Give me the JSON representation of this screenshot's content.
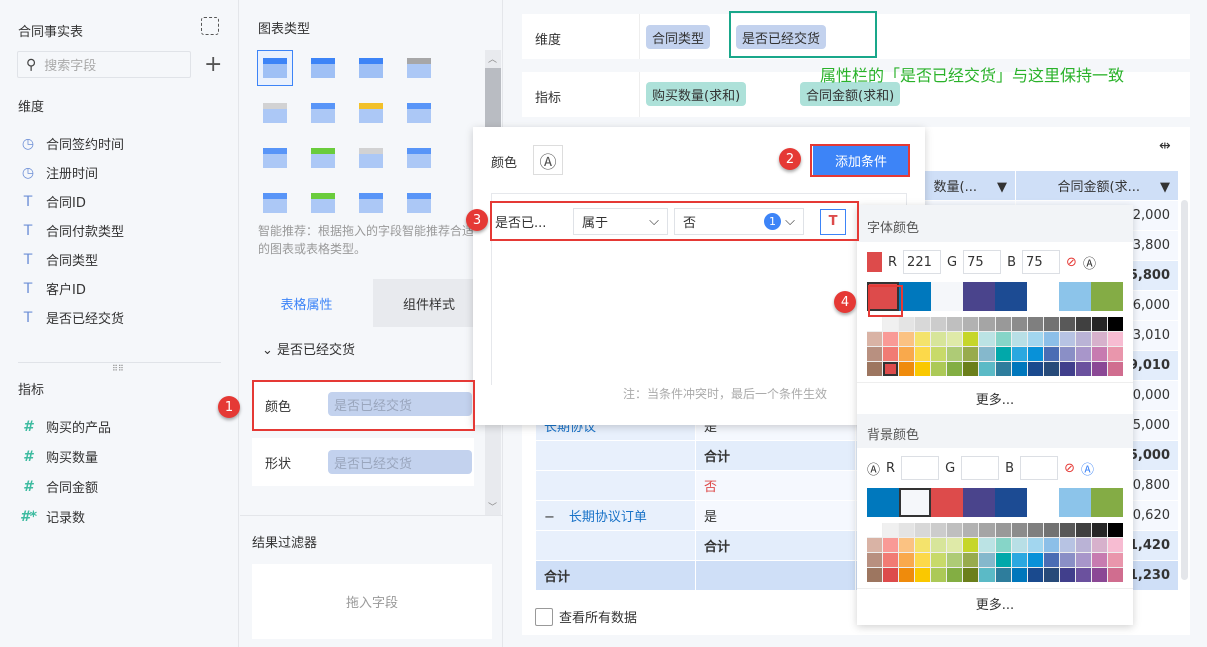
{
  "left": {
    "title": "合同事实表",
    "search_placeholder": "搜索字段",
    "dimensions_label": "维度",
    "dimensions": [
      {
        "icon": "clock-icon",
        "label": "合同签约时间"
      },
      {
        "icon": "clock-icon",
        "label": "注册时间"
      },
      {
        "icon": "text-icon",
        "label": "合同ID"
      },
      {
        "icon": "text-icon",
        "label": "合同付款类型"
      },
      {
        "icon": "text-icon",
        "label": "合同类型"
      },
      {
        "icon": "text-icon",
        "label": "客户ID"
      },
      {
        "icon": "text-icon",
        "label": "是否已经交货"
      }
    ],
    "metrics_label": "指标",
    "metrics": [
      {
        "icon": "number-icon",
        "label": "购买的产品"
      },
      {
        "icon": "number-icon",
        "label": "购买数量"
      },
      {
        "icon": "number-icon",
        "label": "合同金额"
      },
      {
        "icon": "record-count-icon",
        "label": "记录数"
      }
    ]
  },
  "mid": {
    "chart_type_title": "图表类型",
    "hint": "智能推荐：根据拖入的字段智能推荐合适的图表或表格类型。",
    "tabs": [
      "表格属性",
      "组件样式"
    ],
    "section": "是否已经交货",
    "props": [
      {
        "label": "颜色",
        "value": "是否已经交货"
      },
      {
        "label": "形状",
        "value": "是否已经交货"
      }
    ],
    "filter_title": "结果过滤器",
    "filter_placeholder": "拖入字段"
  },
  "top": {
    "dimension_label": "维度",
    "dimensions": [
      "合同类型",
      "是否已经交货"
    ],
    "metric_label": "指标",
    "metrics": [
      "购买数量(求和)",
      "合同金额(求和)"
    ],
    "annotation": "属性栏的「是否已经交货」与这里保持一致"
  },
  "table": {
    "headers": [
      "数量(...",
      "合同金额(求..."
    ],
    "col4": [
      "2,000",
      "3,800",
      "5,800",
      "6,000",
      "3,010",
      "9,010",
      "0,000",
      "5,000",
      "5,000",
      "0,800",
      "0,620",
      "1,420",
      "1,230"
    ],
    "group_partial": "长期协议",
    "group2": "长期协议订单",
    "yes": "是",
    "no": "否",
    "subtotal": "合计",
    "total": "合计",
    "view_all": "查看所有数据"
  },
  "cond": {
    "color_label": "颜色",
    "add_button": "添加条件",
    "field": "是否已...",
    "operator": "属于",
    "value": "否",
    "value_count": "1",
    "note": "注：当条件冲突时，最后一个条件生效"
  },
  "picker": {
    "font_title": "字体颜色",
    "bg_title": "背景颜色",
    "r": "221",
    "g": "75",
    "b": "75",
    "r_label": "R",
    "g_label": "G",
    "b_label": "B",
    "more": "更多...",
    "selected": "#dd4b4b",
    "top": [
      "#dd4b4b",
      "#0078bd",
      "#f5f7fa",
      "#4a448c",
      "#1c4b93",
      "#ffffff",
      "#8cc4ea",
      "#84ac45"
    ],
    "bg_top": [
      "#0078bd",
      "#f5f7fa",
      "#dd4b4b",
      "#4a448c",
      "#1c4b93",
      "#ffffff",
      "#8cc4ea",
      "#84ac45"
    ],
    "grid": [
      "#ffffff",
      "#f0f0f0",
      "#e4e4e4",
      "#d8d8d8",
      "#cccccc",
      "#bfbfbf",
      "#b2b2b2",
      "#a5a5a5",
      "#999999",
      "#8c8c8c",
      "#7f7f7f",
      "#727272",
      "#595959",
      "#404040",
      "#262626",
      "#000000",
      "#d9b3a5",
      "#f99a96",
      "#fbc282",
      "#f4e36c",
      "#d7e59a",
      "#dfeaa8",
      "#c6d62a",
      "#bbe3e4",
      "#86d5c8",
      "#b8dfe6",
      "#a2d6ef",
      "#8cbfe8",
      "#b7c3e3",
      "#bab3d6",
      "#d7b1cc",
      "#f7bcd2",
      "#b89080",
      "#f17b74",
      "#f9a94c",
      "#fcd94a",
      "#c8da6a",
      "#aecb76",
      "#98ab4d",
      "#85b8cc",
      "#01a8aa",
      "#2ba8e0",
      "#0891d8",
      "#4a6db4",
      "#8a8fc6",
      "#a896ca",
      "#c77bb0",
      "#e996ac",
      "#9d7660",
      "#dd4b4b",
      "#ef8b0c",
      "#fac800",
      "#acc957",
      "#83ae43",
      "#6b7f1b",
      "#5bbac6",
      "#2e7d9c",
      "#0077bc",
      "#1a4a8e",
      "#274a79",
      "#413f8c",
      "#6b519e",
      "#8b4895",
      "#d06d8f"
    ]
  },
  "badges": [
    "1",
    "2",
    "3",
    "4"
  ],
  "colors": {
    "accent": "#3d84f7",
    "annotation": "#2ab22a",
    "highlight_red": "#e53935",
    "annotation_box": "#19a78a"
  }
}
